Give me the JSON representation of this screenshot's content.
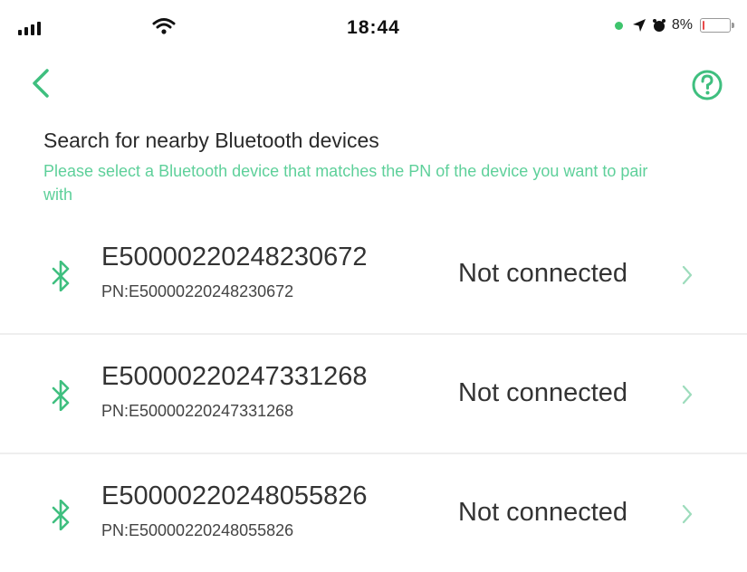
{
  "status_bar": {
    "time": "18:44",
    "battery_text": "8%",
    "battery_level": 0.08,
    "icons": [
      "signal-icon",
      "wifi-icon",
      "location-icon",
      "alarm-icon",
      "battery-icon"
    ]
  },
  "nav": {
    "back_icon": "chevron-left-icon",
    "help_icon": "question-circle-icon"
  },
  "heading": "Search for nearby Bluetooth devices",
  "subtitle": "Please select a Bluetooth device that matches the PN of the device you want to pair with",
  "devices": [
    {
      "name": "E50000220248230672",
      "pn": "PN:E50000220248230672",
      "status": "Not connected"
    },
    {
      "name": "E50000220247331268",
      "pn": "PN:E50000220247331268",
      "status": "Not connected"
    },
    {
      "name": "E50000220248055826",
      "pn": "PN:E50000220248055826",
      "status": "Not connected"
    }
  ],
  "colors": {
    "accent": "#3fbf7f",
    "subtitle": "#5ed09a",
    "battery_low": "#e94b4b"
  }
}
